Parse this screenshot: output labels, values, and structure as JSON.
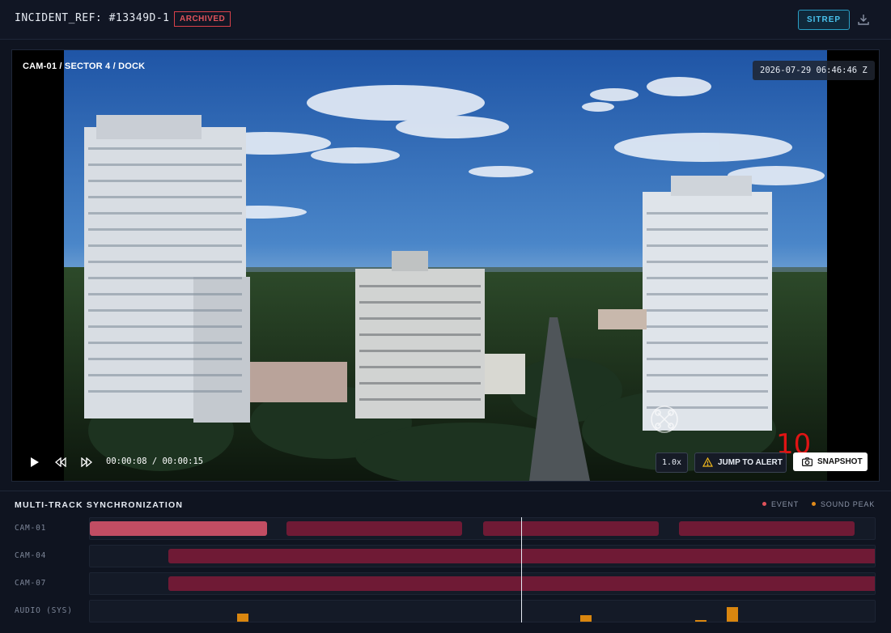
{
  "header": {
    "incident_ref": "INCIDENT_REF: #13349D-1",
    "status_badge": "ARCHIVED",
    "sitrep_label": "SITREP",
    "download_icon": "download-icon"
  },
  "player": {
    "camera_label": "CAM-01 / SECTOR 4 / DOCK",
    "timestamp": "2026-07-29 06:46:46 Z",
    "current_time": "00:00:08",
    "total_time": "00:00:15",
    "time_readout": "00:00:08 / 00:00:15",
    "speed_label": "1.0x",
    "jump_label": "JUMP TO ALERT",
    "snapshot_label": "SNAPSHOT",
    "countdown_overlay": "10",
    "progress_fraction": 0.533,
    "icons": [
      "play-icon",
      "rewind-icon",
      "fast-forward-icon",
      "warning-icon",
      "camera-icon"
    ]
  },
  "timeline": {
    "title": "MULTI-TRACK SYNCHRONIZATION",
    "legend": [
      {
        "label": "EVENT",
        "color": "#e0525a"
      },
      {
        "label": "SOUND PEAK",
        "color": "#e08a1a"
      }
    ],
    "tracks": [
      {
        "label": "CAM-01"
      },
      {
        "label": "CAM-04"
      },
      {
        "label": "CAM-07"
      },
      {
        "label": "AUDIO (SYS)"
      }
    ]
  },
  "colors": {
    "accent": "#49c3ee",
    "archived": "#d9414a",
    "event_segment": "#6f1a35",
    "active_segment": "#c24d63",
    "sound_peak": "#d9860f",
    "background": "#0f1420"
  }
}
